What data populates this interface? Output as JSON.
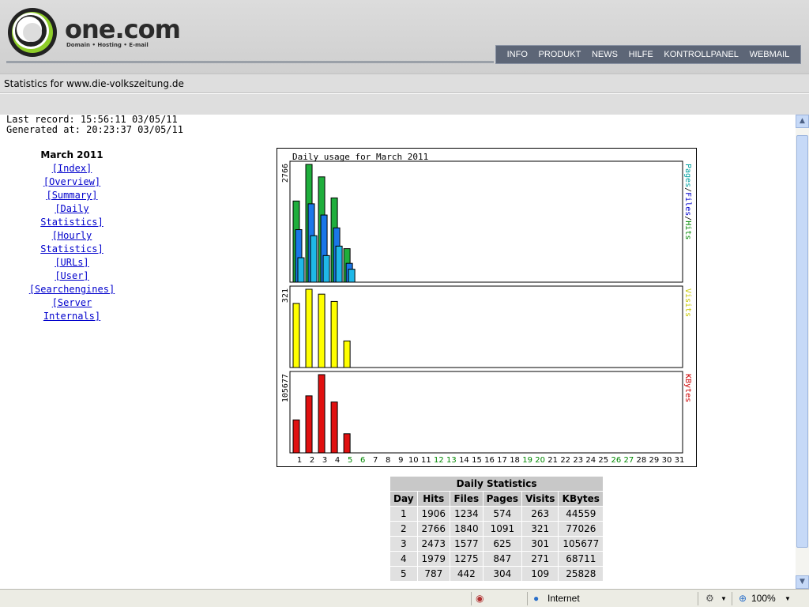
{
  "header": {
    "brand": "one.com",
    "tagline": "Domain • Hosting • E-mail",
    "nav": [
      "INFO",
      "PRODUKT",
      "NEWS",
      "HILFE",
      "KONTROLLPANEL",
      "WEBMAIL"
    ]
  },
  "statsbar": {
    "text": "Statistics for www.die-volkszeitung.de"
  },
  "meta": {
    "last_record": "Last record: 15:56:11 03/05/11",
    "generated": "Generated at: 20:23:37 03/05/11"
  },
  "menu": {
    "title": "March 2011",
    "links": [
      "[Index]",
      "[Overview]",
      "[Summary]",
      "[Daily Statistics]",
      "[Hourly Statistics]",
      "[URLs]",
      "[User]",
      "[Searchengines]",
      "[Server Internals]"
    ]
  },
  "chart_data": {
    "type": "bar",
    "title": "Daily usage for March 2011",
    "x": [
      1,
      2,
      3,
      4,
      5,
      6,
      7,
      8,
      9,
      10,
      11,
      12,
      13,
      14,
      15,
      16,
      17,
      18,
      19,
      20,
      21,
      22,
      23,
      24,
      25,
      26,
      27,
      28,
      29,
      30,
      31
    ],
    "weekend_days": [
      5,
      6,
      12,
      13,
      19,
      20,
      26,
      27
    ],
    "panels": [
      {
        "max_label": "2766",
        "label_parts": [
          "Pages",
          "/",
          "Files",
          "/",
          "Hits"
        ],
        "series": [
          {
            "name": "Hits",
            "color": "#1fae3c",
            "values": [
              1906,
              2766,
              2473,
              1979,
              787
            ]
          },
          {
            "name": "Files",
            "color": "#1a77e8",
            "values": [
              1234,
              1840,
              1577,
              1275,
              442
            ]
          },
          {
            "name": "Pages",
            "color": "#1fb8e8",
            "values": [
              574,
              1091,
              625,
              847,
              304
            ]
          }
        ]
      },
      {
        "max_label": "321",
        "label_parts": [
          "Visits"
        ],
        "series": [
          {
            "name": "Visits",
            "color": "#ffff00",
            "values": [
              263,
              321,
              301,
              271,
              109
            ]
          }
        ]
      },
      {
        "max_label": "105677",
        "label_parts": [
          "KBytes"
        ],
        "series": [
          {
            "name": "KBytes",
            "color": "#e01010",
            "values": [
              44559,
              77026,
              105677,
              68711,
              25828
            ]
          }
        ]
      }
    ],
    "colors": {
      "weekday": "#000000",
      "weekend": "#008800",
      "pages": "#00a0a0",
      "files": "#0000cc",
      "hits": "#008800",
      "visits": "#c8c800",
      "kbytes": "#cc0000"
    }
  },
  "table": {
    "caption": "Daily Statistics",
    "headers": [
      "Day",
      "Hits",
      "Files",
      "Pages",
      "Visits",
      "KBytes"
    ],
    "rows": [
      [
        "1",
        "1906",
        "1234",
        "574",
        "263",
        "44559"
      ],
      [
        "2",
        "2766",
        "1840",
        "1091",
        "321",
        "77026"
      ],
      [
        "3",
        "2473",
        "1577",
        "625",
        "301",
        "105677"
      ],
      [
        "4",
        "1979",
        "1275",
        "847",
        "271",
        "68711"
      ],
      [
        "5",
        "787",
        "442",
        "304",
        "109",
        "25828"
      ]
    ]
  },
  "statusbar": {
    "zone": "Internet",
    "zoom": "100%"
  },
  "icons": [
    "privacy-eye-icon",
    "globe-icon",
    "settings-icon",
    "zoom-icon",
    "dropdown-arrow-icon",
    "scroll-up-icon",
    "scroll-down-icon"
  ]
}
